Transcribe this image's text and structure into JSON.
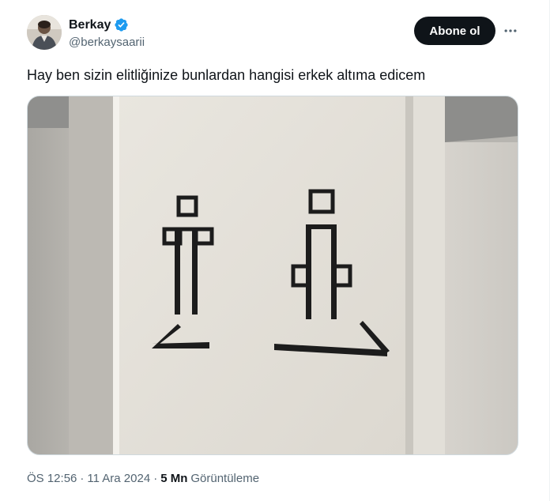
{
  "author": {
    "display_name": "Berkay",
    "handle": "@berkaysaarii"
  },
  "actions": {
    "follow_label": "Abone ol",
    "more_icon": "more-horizontal-icon"
  },
  "tweet": {
    "text": "Hay ben sizin elitliğinize bunlardan hangisi erkek altıma edicem",
    "media_description_icon": "photo"
  },
  "meta": {
    "time": "ÖS 12:56",
    "separator": "·",
    "date": "11 Ara 2024",
    "views_count": "5 Mn",
    "views_label": "Görüntüleme"
  },
  "colors": {
    "text_primary": "#0f1419",
    "text_secondary": "#536471",
    "verified_blue": "#1d9bf0",
    "button_bg": "#0f1419"
  }
}
